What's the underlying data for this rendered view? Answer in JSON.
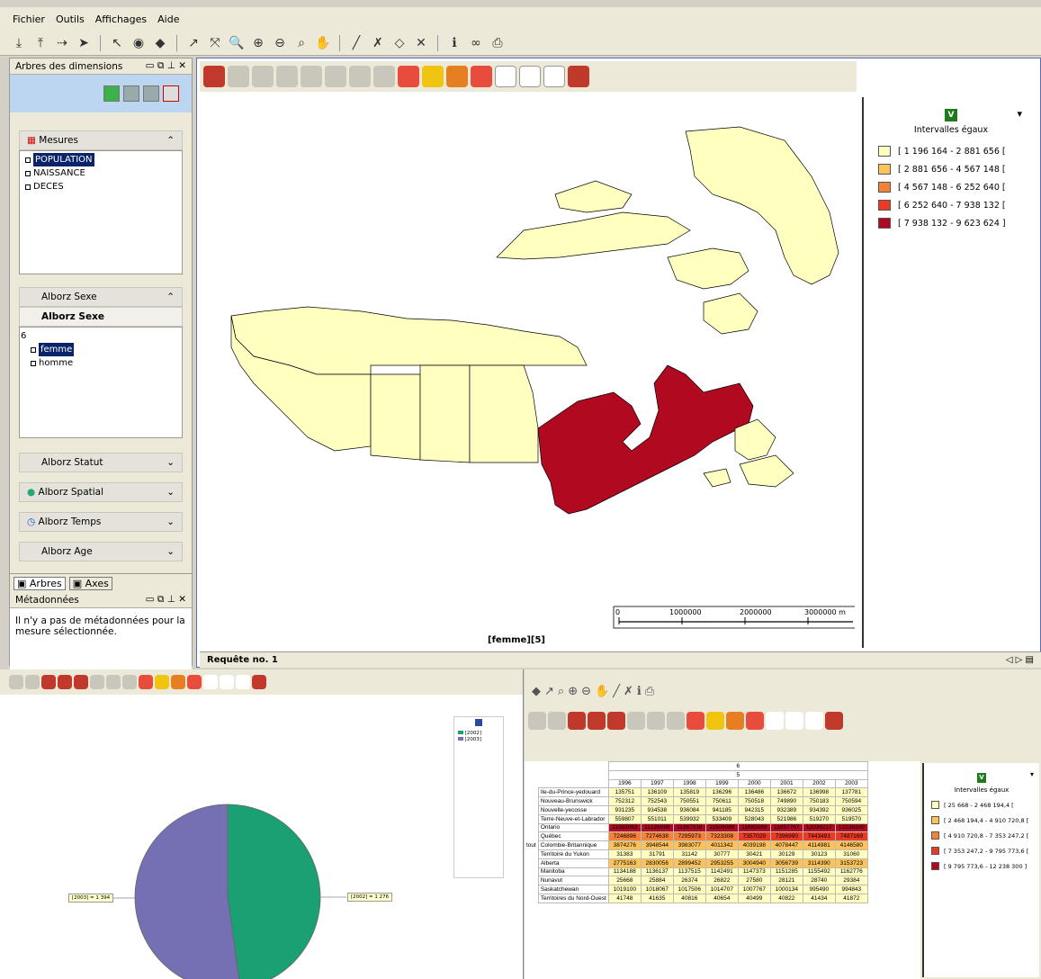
{
  "menu": [
    "Fichier",
    "Outils",
    "Affichages",
    "Aide"
  ],
  "left_panel": {
    "title": "Arbres des dimensions",
    "measures_head": "Mesures",
    "measures": [
      "POPULATION",
      "NAISSANCE",
      "DECES"
    ],
    "sexe_head": "Alborz Sexe",
    "sexe_sub": "Alborz Sexe",
    "sexe_root": "6",
    "sexe_items": [
      "femme",
      "homme"
    ],
    "sections": [
      "Alborz Statut",
      "Alborz Spatial",
      "Alborz Temps",
      "Alborz Age"
    ],
    "tabs": [
      "Arbres",
      "Axes"
    ],
    "meta_title": "Métadonnées",
    "meta_text": "Il n'y a pas de métadonnées pour la mesure sélectionnée."
  },
  "map": {
    "caption": "[femme][5]",
    "scale_labels": [
      "0",
      "1000000",
      "2000000",
      "3000000 m"
    ],
    "tab": "Requête no. 1"
  },
  "legend": {
    "badge": "V",
    "title": "Intervalles égaux",
    "classes": [
      {
        "label": "[ 1 196 164 - 2 881 656 [",
        "color": "#ffffc0"
      },
      {
        "label": "[ 2 881 656 - 4 567 148 [",
        "color": "#fdc35a"
      },
      {
        "label": "[ 4 567 148 - 6 252 640 [",
        "color": "#f5823a"
      },
      {
        "label": "[ 6 252 640 - 7 938 132 [",
        "color": "#ea3a24"
      },
      {
        "label": "[ 7 938 132 - 9 623 624 ]",
        "color": "#b10a20"
      }
    ]
  },
  "pie": {
    "legend": [
      "[2002]",
      "[2003]"
    ],
    "labels": [
      "[2003] = 1 394",
      "[2002] = 1 276"
    ],
    "colors": [
      "#1aa073",
      "#7570b3"
    ],
    "chart_data": {
      "type": "pie",
      "labels": [
        "[2002]",
        "[2003]"
      ],
      "values": [
        1276,
        1394
      ]
    }
  },
  "table": {
    "top": "6",
    "sub": "5",
    "row_group": "tout",
    "years": [
      "1996",
      "1997",
      "1998",
      "1999",
      "2000",
      "2001",
      "2002",
      "2003"
    ],
    "rows": [
      {
        "name": "Ile-du-Prince-yedouard",
        "vals": [
          "135751",
          "136109",
          "135819",
          "136296",
          "136486",
          "136672",
          "136998",
          "137781"
        ]
      },
      {
        "name": "Nouveau-Brunswick",
        "vals": [
          "752312",
          "752543",
          "750551",
          "750611",
          "750518",
          "749890",
          "750183",
          "750594"
        ]
      },
      {
        "name": "Nouvelle-yecosse",
        "vals": [
          "931235",
          "934538",
          "936084",
          "941185",
          "942315",
          "932389",
          "934392",
          "936025"
        ]
      },
      {
        "name": "Terre-Neuve-et-Labrador",
        "vals": [
          "559807",
          "551011",
          "539932",
          "533409",
          "528043",
          "521986",
          "519270",
          "519570"
        ]
      },
      {
        "name": "Ontario",
        "vals": [
          "11083083",
          "11226089",
          "11367018",
          "11506089",
          "11685089",
          "11857767",
          "12036217",
          "12238300"
        ]
      },
      {
        "name": "Québec",
        "vals": [
          "7246896",
          "7274638",
          "7295973",
          "7323308",
          "7357029",
          "7396990",
          "7443491",
          "7487169"
        ]
      },
      {
        "name": "Colombie-Britannique",
        "vals": [
          "3874276",
          "3948544",
          "3983077",
          "4011342",
          "4039198",
          "4078447",
          "4114981",
          "4146580"
        ]
      },
      {
        "name": "Territoire du Yukon",
        "vals": [
          "31383",
          "31791",
          "31142",
          "30777",
          "30421",
          "30129",
          "30123",
          "31060"
        ]
      },
      {
        "name": "Alberta",
        "vals": [
          "2775163",
          "2830056",
          "2899452",
          "2953255",
          "3004940",
          "3056739",
          "3114390",
          "3153723"
        ]
      },
      {
        "name": "Manitoba",
        "vals": [
          "1134188",
          "1136137",
          "1137515",
          "1142491",
          "1147373",
          "1151285",
          "1155492",
          "1162776"
        ]
      },
      {
        "name": "Nunavut",
        "vals": [
          "25668",
          "25884",
          "26374",
          "26822",
          "27580",
          "28121",
          "28740",
          "29384"
        ]
      },
      {
        "name": "Saskatchewan",
        "vals": [
          "1019100",
          "1018067",
          "1017506",
          "1014707",
          "1007767",
          "1000134",
          "995490",
          "994843"
        ]
      },
      {
        "name": "Territoires du Nord-Ouest",
        "vals": [
          "41748",
          "41635",
          "40816",
          "40654",
          "40499",
          "40822",
          "41434",
          "41872"
        ]
      }
    ]
  },
  "legend2": {
    "badge": "V",
    "title": "Intervalles égaux",
    "classes": [
      {
        "label": "[ 25 668 - 2 468 194,4 [",
        "color": "#ffffc0"
      },
      {
        "label": "[ 2 468 194,4 - 4 910 720,8 [",
        "color": "#fdc35a"
      },
      {
        "label": "[ 4 910 720,8 - 7 353 247,2 [",
        "color": "#f5823a"
      },
      {
        "label": "[ 7 353 247,2 - 9 795 773,6 [",
        "color": "#ea3a24"
      },
      {
        "label": "[ 9 795 773,6 - 12 238 300 ]",
        "color": "#b10a20"
      }
    ]
  }
}
